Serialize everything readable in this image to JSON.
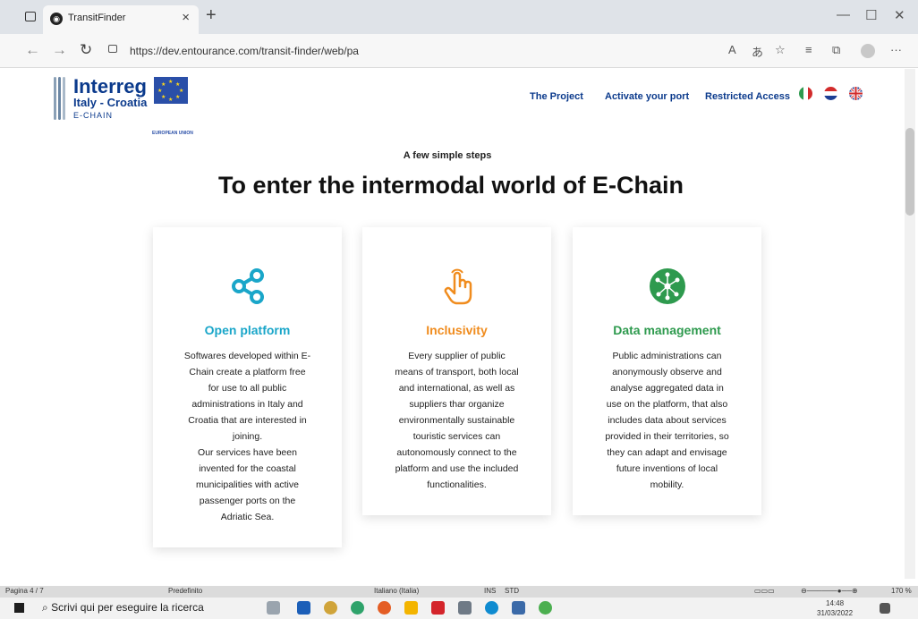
{
  "browser": {
    "tab_title": "TransitFinder",
    "url": "https://dev.entourance.com/transit-finder/web/pa",
    "new_tab": "+",
    "tab_close": "×"
  },
  "logo": {
    "main": "Interreg",
    "sub": "Italy - Croatia",
    "tagline": "E-CHAIN",
    "eu_caption": "EUROPEAN UNION"
  },
  "nav": {
    "project": "The Project",
    "activate": "Activate your port",
    "restricted": "Restricted Access"
  },
  "hero": {
    "kicker": "A few simple steps",
    "headline": "To enter the intermodal world of E-Chain"
  },
  "cards": [
    {
      "title": "Open platform",
      "icon": "share-icon",
      "color": "#1aa6c9",
      "text": "Softwares developed within E-\nChain create a platform free\nfor use to all public\nadministrations in Italy and\nCroatia that are interested in\njoining.\nOur services have been\ninvented for the coastal\nmunicipalities with active\npassenger ports on the\nAdriatic Sea."
    },
    {
      "title": "Inclusivity",
      "icon": "hand-pointer-icon",
      "color": "#f08c1e",
      "text": "Every supplier of public\nmeans of transport, both local\nand international, as well as\nsuppliers thar organize\nenvironmentally sustainable\ntouristic services can\nautonomously connect to the\nplatform and use the included\nfunctionalities."
    },
    {
      "title": "Data management",
      "icon": "network-icon",
      "color": "#2e9a4e",
      "text": "Public administrations can\nanonymously observe and\nanalyse aggregated data in\nuse on the platform, that also\nincludes data about services\nprovided in their territories, so\nthey can adapt and envisage\nfuture inventions of local\nmobility."
    }
  ],
  "status": {
    "page": "Pagina 4 / 7",
    "style": "Predefinito",
    "lang": "Italiano (Italia)",
    "ins": "INS",
    "std": "STD",
    "zoom": "170 %"
  },
  "taskbar": {
    "search": "Scrivi qui per eseguire la ricerca",
    "time": "14:48",
    "date": "31/03/2022"
  }
}
